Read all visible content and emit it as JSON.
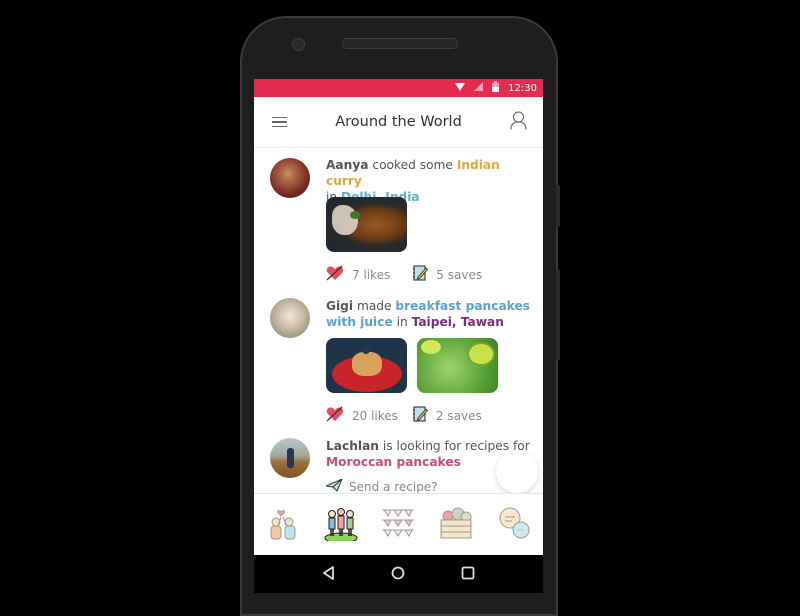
{
  "status_bar": {
    "time": "12:30",
    "icons": [
      "wifi-icon",
      "signal-icon",
      "battery-icon"
    ],
    "color": "#e52b50"
  },
  "app_bar": {
    "title": "Around the World",
    "menu_icon": "hamburger-menu-icon",
    "profile_icon": "user-profile-icon"
  },
  "feed": [
    {
      "user": "Aanya",
      "verb": " cooked some ",
      "dish": "Indian curry",
      "dish_color": "#e8a63a",
      "connector": "in ",
      "place": "Delhi, India",
      "place_color": "#5db3c5",
      "images": [
        "indian-curry-photo"
      ],
      "likes": "7 likes",
      "saves": "5 saves"
    },
    {
      "user": "Gigi",
      "verb": " made ",
      "dish_line1": "breakfast pancakes",
      "dish_line2": "with juice",
      "dish_color": "#5ba3cf",
      "connector": " in ",
      "place": "Taipei, Tawan",
      "place_color": "#7b2d7b",
      "images": [
        "pancakes-photo",
        "kiwi-juice-photo"
      ],
      "likes": "20 likes",
      "saves": "2 saves"
    },
    {
      "user": "Lachlan",
      "verb": " is looking for recipes for",
      "dish": "Moroccan pancakes",
      "dish_color": "#c8506a",
      "action": "Send a recipe?"
    }
  ],
  "bottom_nav": [
    {
      "name": "friends-tab",
      "icon": "friends-high-five-icon"
    },
    {
      "name": "community-tab",
      "icon": "people-group-icon",
      "active": true
    },
    {
      "name": "events-tab",
      "icon": "bunting-flags-icon"
    },
    {
      "name": "groceries-tab",
      "icon": "vegetable-crate-icon"
    },
    {
      "name": "messages-tab",
      "icon": "chat-bubbles-icon"
    }
  ],
  "system_nav": [
    "back-button",
    "home-button",
    "recents-button"
  ]
}
